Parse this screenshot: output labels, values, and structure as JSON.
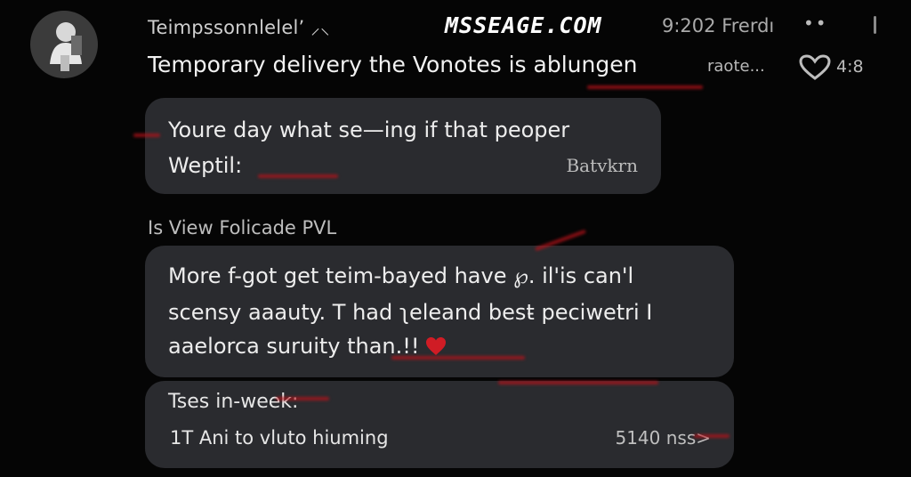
{
  "header": {
    "sender": "Teimpssonnlelelʼ ⸝⸜",
    "brand": "MSSEAGE.COM",
    "time": "9:202 Frerdı",
    "more": "••",
    "subject": "Temporary delivery the Vonotes is ablungen",
    "subject_more": "raote...",
    "reply_count": "4:8"
  },
  "message1": {
    "line1": "Youre day what se—ing if that peoper",
    "line2": "Weptil:",
    "signature": "Batvkrn"
  },
  "view_label": "Is View Folicade PVL",
  "message2": {
    "line1": "More f-got get teim-bayed have ℘. il'is can'l",
    "line2": "scensy aaauty. T had ʅeleand best̵ peciwetri I",
    "line3": "aaelorca suruity than.!!"
  },
  "attachment": {
    "title": "Tses in-week:",
    "name": "1T Ani to vluto hiuming",
    "size": "5140 nss>"
  },
  "colors": {
    "background": "#050505",
    "bubble": "#2a2b2f",
    "accent_red": "#b8121a",
    "heart": "#d01c25"
  },
  "icons": {
    "avatar": "avatar-silhouette-icon",
    "reaction": "heart-outline-icon",
    "inline": "heart-icon"
  }
}
